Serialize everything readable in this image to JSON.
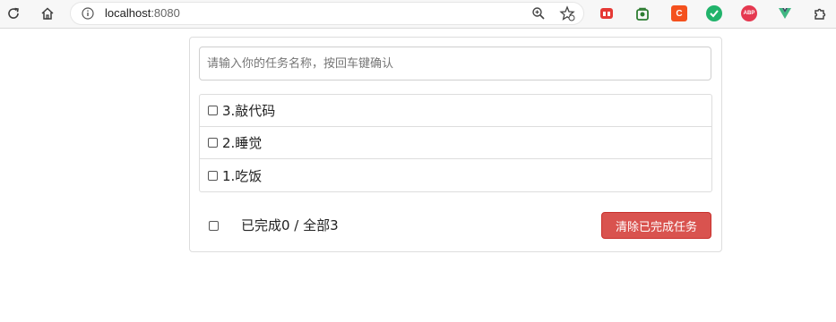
{
  "browser": {
    "url_host": "localhost",
    "url_port": ":8080",
    "icons": [
      "reload-icon",
      "home-icon",
      "info-icon",
      "zoom-icon",
      "bookmark-star-icon"
    ],
    "extensions": [
      {
        "name": "extension-red-icon",
        "label": "",
        "color": "#e53935"
      },
      {
        "name": "extension-green-bag-icon",
        "label": "",
        "color": "#2e7d32"
      },
      {
        "name": "extension-c-icon",
        "label": "C",
        "color": "#f4511e"
      },
      {
        "name": "extension-green-check-icon",
        "label": "",
        "color": "#21b36b"
      },
      {
        "name": "adblock-plus-icon",
        "label": "ABP",
        "color": "#e53950"
      },
      {
        "name": "vue-devtools-icon",
        "label": "",
        "color": "#41b883"
      },
      {
        "name": "extensions-puzzle-icon",
        "label": "",
        "color": "#3c3c3c"
      }
    ]
  },
  "todo": {
    "input_placeholder": "请输入你的任务名称，按回车键确认",
    "items": [
      {
        "label": "3.敲代码",
        "done": false
      },
      {
        "label": "2.睡觉",
        "done": false
      },
      {
        "label": "1.吃饭",
        "done": false
      }
    ],
    "footer": {
      "summary": "已完成0 / 全部3",
      "clear_button": "清除已完成任务"
    },
    "colors": {
      "danger": "#d9534f"
    }
  }
}
